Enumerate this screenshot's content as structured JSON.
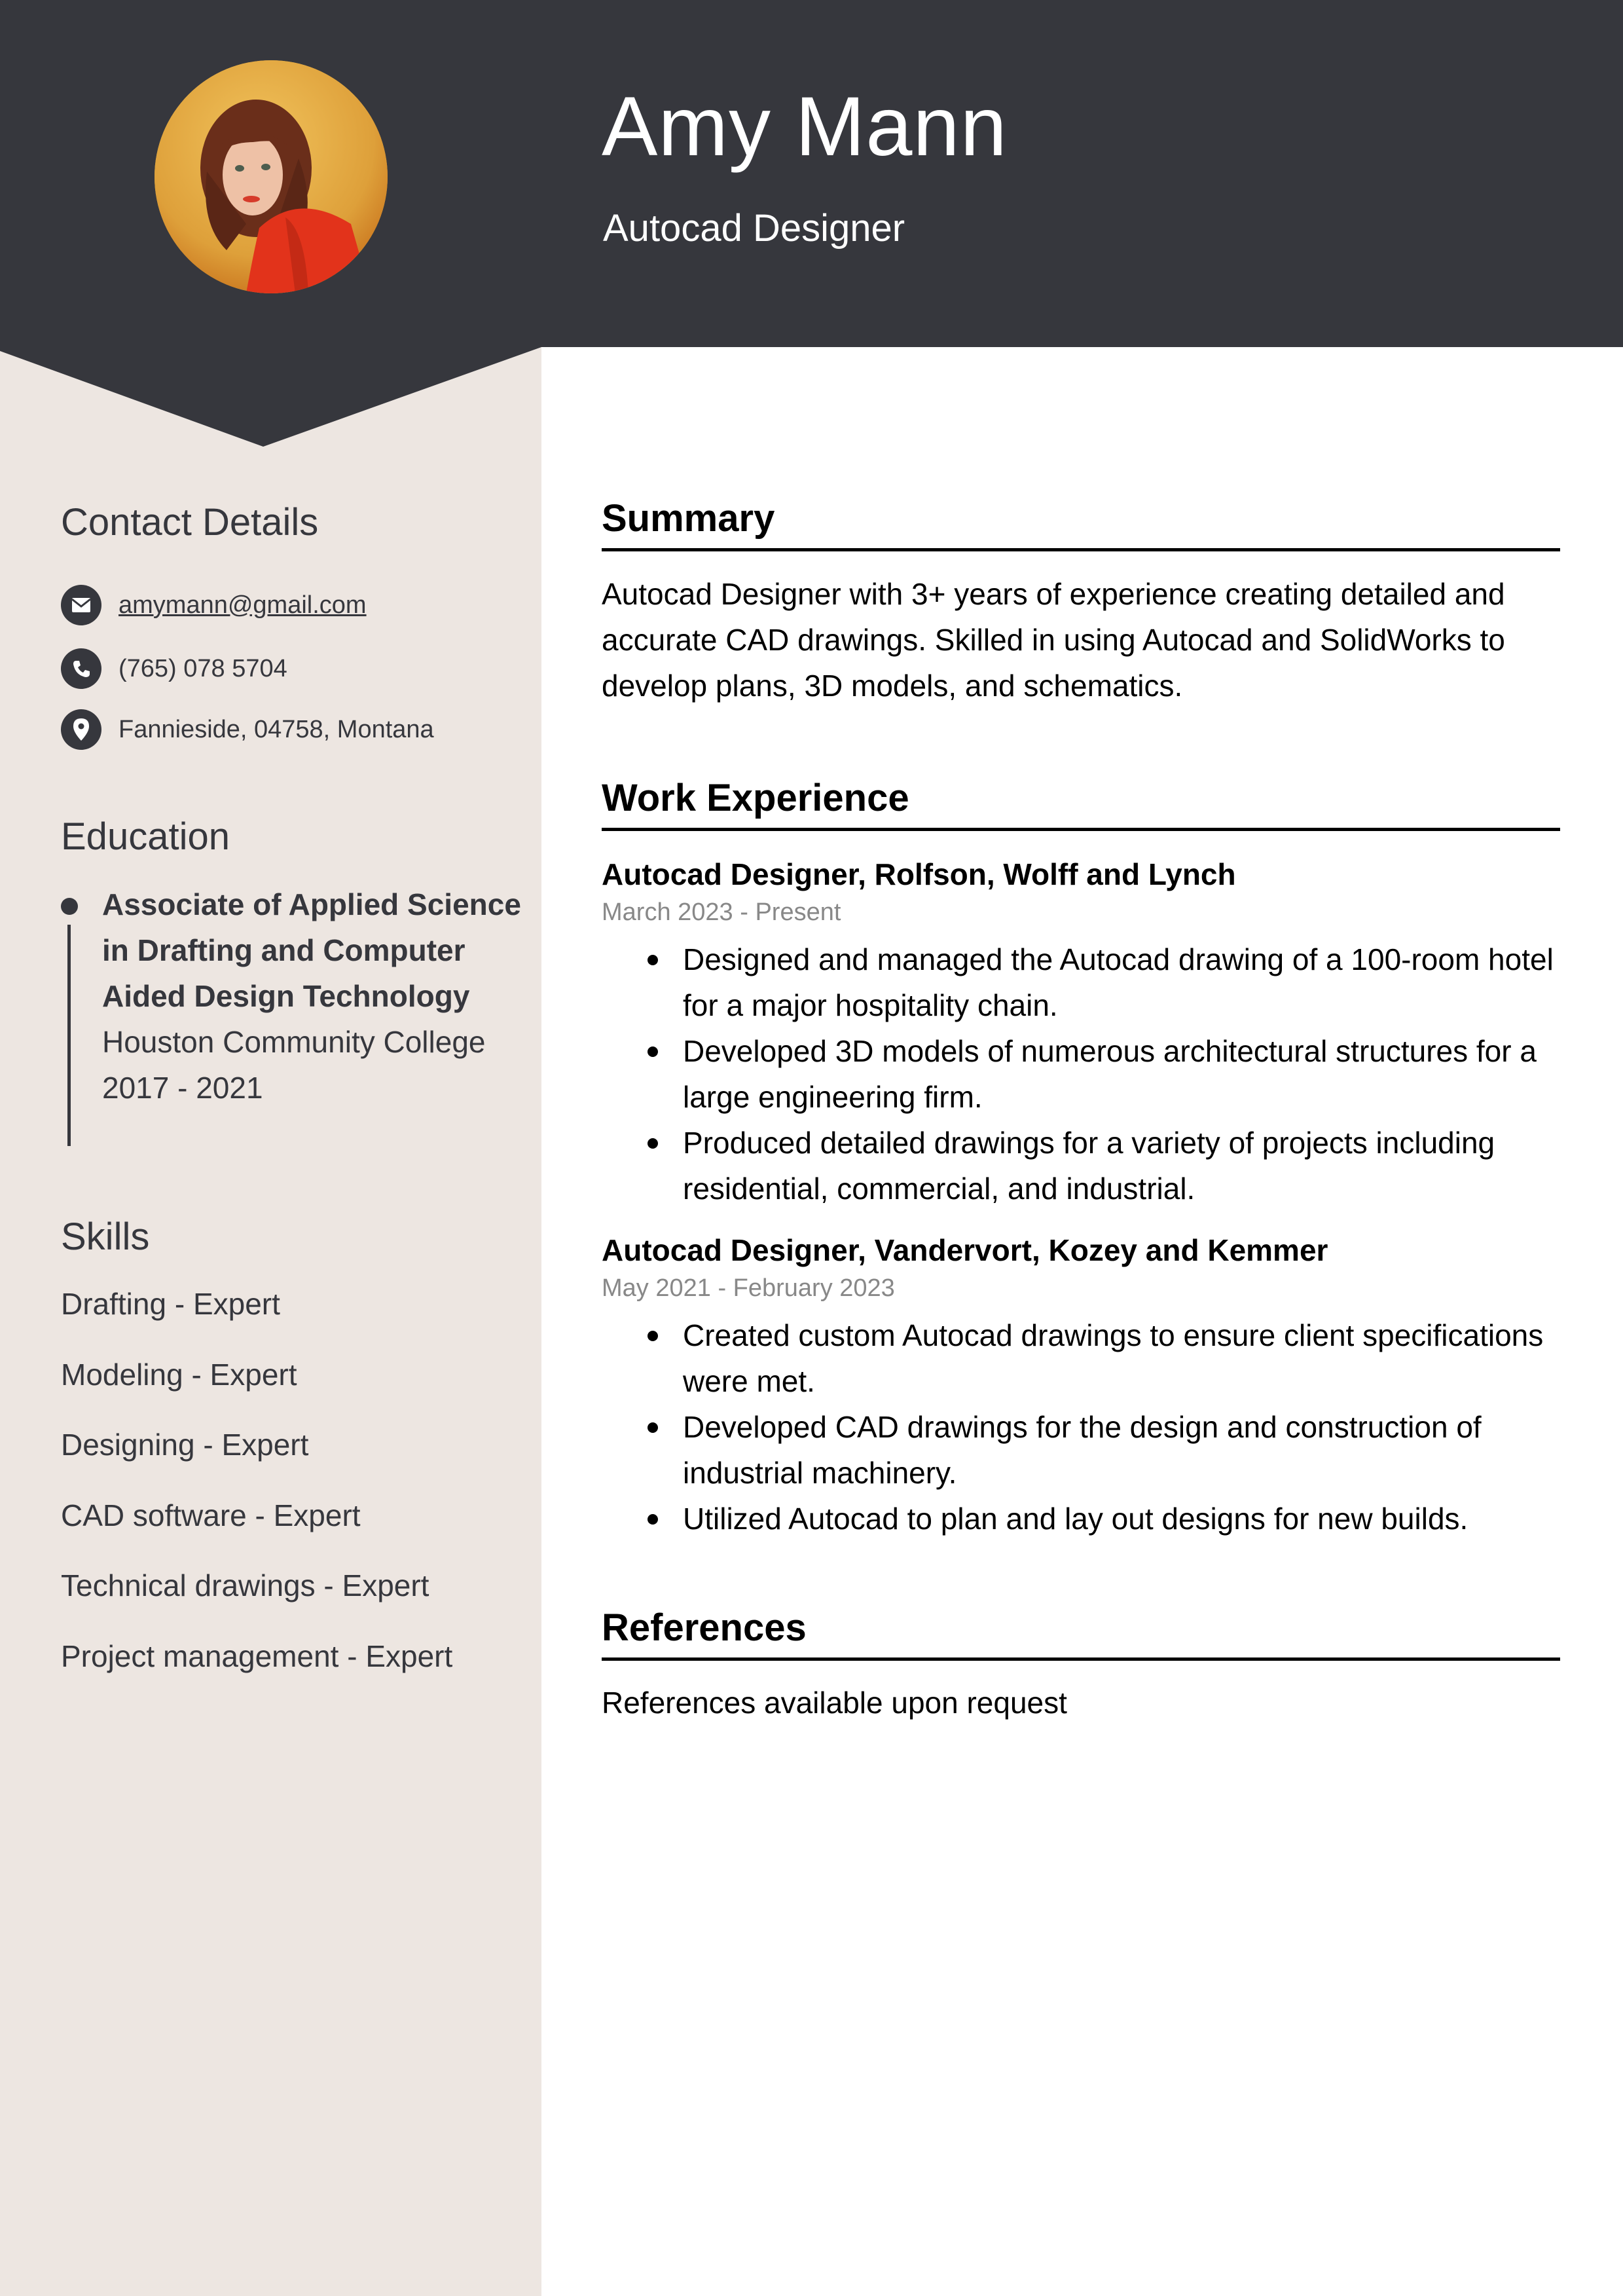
{
  "header": {
    "name": "Amy Mann",
    "job_title": "Autocad Designer",
    "photo_alt": "profile-photo"
  },
  "sidebar": {
    "contact": {
      "heading": "Contact Details",
      "items": [
        {
          "icon": "envelope-icon",
          "text": "amymann@gmail.com",
          "is_link": true
        },
        {
          "icon": "phone-icon",
          "text": "(765) 078 5704",
          "is_link": false
        },
        {
          "icon": "map-pin-icon",
          "text": "Fannieside, 04758, Montana",
          "is_link": false
        }
      ]
    },
    "education": {
      "heading": "Education",
      "degree": "Associate of Applied Science in Drafting and Computer Aided Design Technology",
      "school": "Houston Community College",
      "years": "2017 - 2021"
    },
    "skills": {
      "heading": "Skills",
      "items": [
        "Drafting - Expert",
        "Modeling - Expert",
        "Designing - Expert",
        "CAD software - Expert",
        "Technical drawings - Expert",
        "Project management - Expert"
      ]
    }
  },
  "main": {
    "summary": {
      "heading": "Summary",
      "text": "Autocad Designer with 3+ years of experience creating detailed and accurate CAD drawings. Skilled in using Autocad and SolidWorks to develop plans, 3D models, and schematics."
    },
    "work": {
      "heading": "Work Experience",
      "jobs": [
        {
          "title": "Autocad Designer, Rolfson, Wolff and Lynch",
          "dates": "March 2023 - Present",
          "bullets": [
            "Designed and managed the Autocad drawing of a 100-room hotel for a major hospitality chain.",
            "Developed 3D models of numerous architectural structures for a large engineering firm.",
            "Produced detailed drawings for a variety of projects including residential, commercial, and industrial."
          ]
        },
        {
          "title": "Autocad Designer, Vandervort, Kozey and Kemmer",
          "dates": "May 2021 - February 2023",
          "bullets": [
            "Created custom Autocad drawings to ensure client specifications were met.",
            "Developed CAD drawings for the design and construction of industrial machinery.",
            "Utilized Autocad to plan and lay out designs for new builds."
          ]
        }
      ]
    },
    "references": {
      "heading": "References",
      "text": "References available upon request"
    }
  },
  "colors": {
    "header_bg": "#36373d",
    "sidebar_bg": "#ede6e1",
    "text_dark": "#36373d",
    "date_gray": "#888888"
  }
}
